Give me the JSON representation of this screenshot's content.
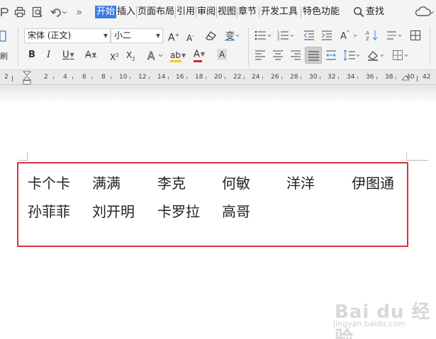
{
  "menubar": {
    "tabs": [
      {
        "label": "开始",
        "active": true
      },
      {
        "label": "插入"
      },
      {
        "label": "页面布局"
      },
      {
        "label": "引用"
      },
      {
        "label": "审阅"
      },
      {
        "label": "视图"
      },
      {
        "label": "章节"
      },
      {
        "label": "开发工具"
      },
      {
        "label": "特色功能"
      }
    ],
    "more_glyph": "»",
    "search_label": "查找",
    "active_color": "#3c7de6"
  },
  "ribbon": {
    "font_name": "宋体 (正文)",
    "font_size": "小二",
    "paste_label": "刷"
  },
  "ruler": {
    "numbers": [
      "2",
      "2",
      "4",
      "6",
      "8",
      "10",
      "12",
      "14",
      "16",
      "18",
      "20",
      "22",
      "24",
      "26",
      "28",
      "30",
      "32",
      "34",
      "36",
      "38",
      "40",
      "42"
    ]
  },
  "document": {
    "rows": [
      [
        "卡个卡",
        "满满",
        "李克",
        "何敏",
        "洋洋",
        "伊图通"
      ],
      [
        "孙菲菲",
        "刘开明",
        "卡罗拉",
        "高哥"
      ]
    ],
    "border_color": "#d9343a"
  },
  "watermark": {
    "logo": "Bai du 经验",
    "url": "jingyan.baidu.com"
  }
}
